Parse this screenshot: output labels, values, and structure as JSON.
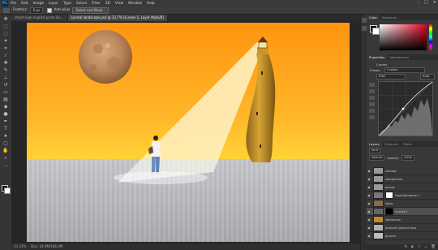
{
  "app": {
    "logo": "Ps"
  },
  "menu": [
    "File",
    "Edit",
    "Image",
    "Layer",
    "Type",
    "Select",
    "Filter",
    "3D",
    "View",
    "Window",
    "Help"
  ],
  "window_controls": [
    "–",
    "□",
    "✕"
  ],
  "options": {
    "feather_label": "Feather:",
    "feather_value": "0 px",
    "antialias_label": "Anti-alias",
    "button_label": "Select and Mask..."
  },
  "tabs": [
    {
      "label": "street-sign-english-posts-illu...",
      "active": false
    },
    {
      "label": "surreal landscape.psd @ 33.7% (Curves 1, Layer Mask/8)",
      "active": true
    }
  ],
  "status": {
    "zoom": "33.33%",
    "doc": "Doc: 24.9M/186.4M"
  },
  "colors": {
    "fg": "#000000",
    "bg": "#ffffff"
  },
  "panels": {
    "color_tabs": [
      "Color",
      "Swatches"
    ],
    "properties_tabs": [
      "Properties",
      "Adjustments"
    ],
    "properties": {
      "type_label": "Curves",
      "preset_label": "Preset:",
      "preset_value": "Custom",
      "channel_value": "RGB",
      "auto_label": "Auto"
    },
    "layers_tabs": [
      "Layers",
      "Channels",
      "Paths"
    ],
    "layer_controls": {
      "kind": "Kind",
      "blend": "Normal",
      "opacity_label": "Opacity:",
      "opacity_value": "100%",
      "lock_label": "Lock:",
      "fill_label": "Fill:",
      "fill_value": "100%"
    },
    "layers": [
      {
        "name": "shadow",
        "selected": false
      },
      {
        "name": "shadow box",
        "selected": false
      },
      {
        "name": "person",
        "selected": false
      },
      {
        "name": "Hue/Saturation 1",
        "selected": false
      },
      {
        "name": "Moon",
        "selected": false
      },
      {
        "name": "Curves 1",
        "selected": true
      },
      {
        "name": "lighthouse",
        "selected": false
      },
      {
        "name": "textured ground floor",
        "selected": false
      },
      {
        "name": "ground",
        "selected": false
      }
    ],
    "bottom_icons": [
      "fx",
      "◐",
      "▢",
      "＋",
      "🗑"
    ]
  }
}
